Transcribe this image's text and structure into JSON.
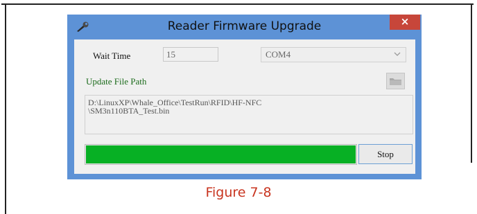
{
  "dialog": {
    "title": "Reader Firmware Upgrade",
    "close_label": "×",
    "wait_time_label": "Wait Time",
    "wait_time_value": "15",
    "com_port_value": "COM4",
    "update_path_label": "Update File Path",
    "file_path_line1": "D:\\LinuxXP\\Whale_Office\\TestRun\\RFID\\HF-NFC",
    "file_path_line2": "\\SM3n110BTA_Test.bin",
    "progress_fraction": 1.0,
    "stop_label": "Stop"
  },
  "caption": "Figure 7-8",
  "colors": {
    "titlebar": "#5d92d6",
    "close_button": "#c7463a",
    "progress_fill": "#07b024",
    "caption": "#c8341f",
    "path_label": "#1b6b1b"
  }
}
